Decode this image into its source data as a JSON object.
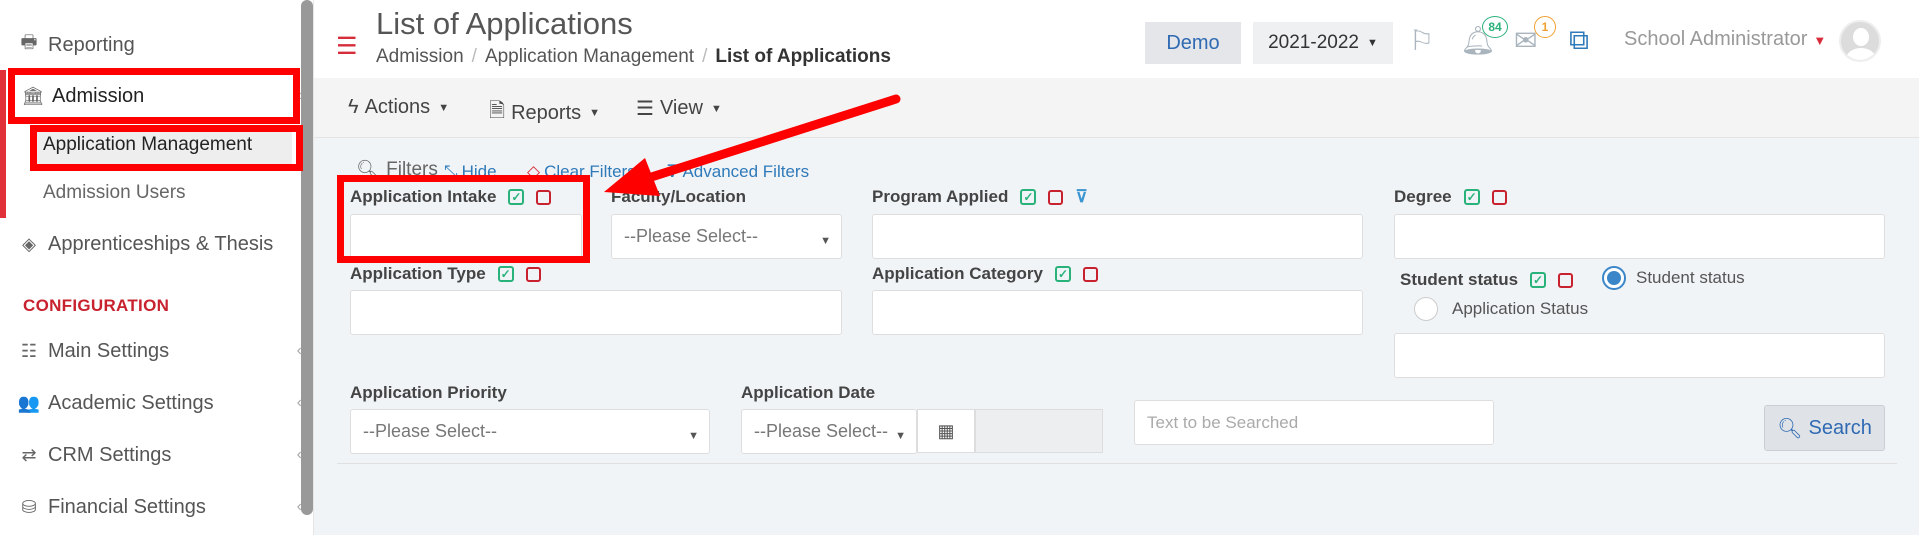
{
  "sidebar": {
    "items": [
      {
        "label": "Reporting",
        "icon": "printer-icon"
      },
      {
        "label": "Admission",
        "icon": "bank-icon"
      },
      {
        "label": "Apprenticeships & Thesis",
        "icon": "cube-icon"
      },
      {
        "label": "Main Settings",
        "icon": "sliders-icon"
      },
      {
        "label": "Academic Settings",
        "icon": "users-icon"
      },
      {
        "label": "CRM Settings",
        "icon": "shuffle-icon"
      },
      {
        "label": "Financial Settings",
        "icon": "coins-icon"
      }
    ],
    "subitems": [
      {
        "label": "Application Management"
      },
      {
        "label": "Admission Users"
      }
    ],
    "section": "CONFIGURATION"
  },
  "header": {
    "title": "List of Applications",
    "breadcrumb": [
      "Admission",
      "Application Management",
      "List of Applications"
    ],
    "demo": "Demo",
    "year": "2021-2022",
    "notifications": "84",
    "messages": "1",
    "user": "School Administrator"
  },
  "toolbar": {
    "actions": "Actions",
    "reports": "Reports",
    "view": "View"
  },
  "filters": {
    "title": "Filters",
    "hide": "Hide",
    "clear": "Clear Filters",
    "advanced": "Advanced Filters",
    "application_intake": "Application Intake",
    "faculty_location": "Faculty/Location",
    "faculty_placeholder": "--Please Select--",
    "program_applied": "Program Applied",
    "degree": "Degree",
    "application_type": "Application Type",
    "application_category": "Application Category",
    "student_status": "Student status",
    "radio_student_status": "Student status",
    "radio_application_status": "Application Status",
    "application_priority": "Application Priority",
    "priority_placeholder": "--Please Select--",
    "application_date": "Application Date",
    "date_placeholder": "--Please Select--",
    "search_placeholder": "Text to be Searched",
    "search_button": "Search"
  },
  "colors": {
    "accent_red": "#d62d3a",
    "highlight": "#ff0000",
    "link_blue": "#2f7ab9"
  }
}
